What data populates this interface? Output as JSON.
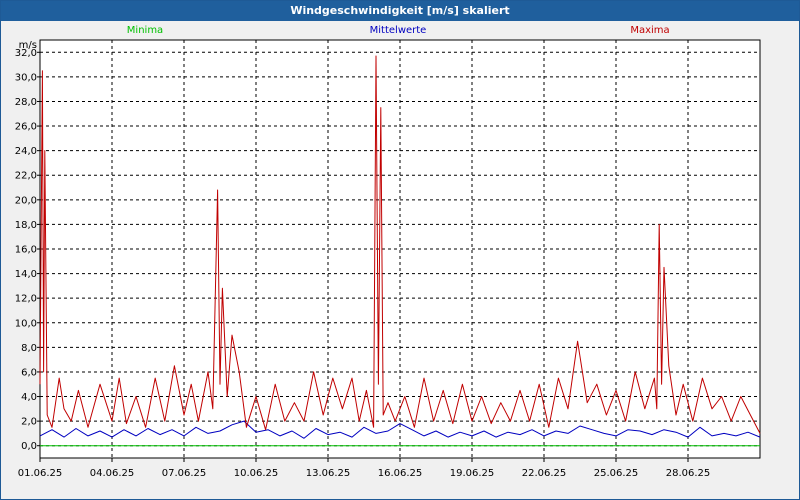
{
  "window": {
    "title": "Windgeschwindigkeit [m/s] skaliert"
  },
  "chart_data": {
    "type": "line",
    "title": "Windgeschwindigkeit [m/s] skaliert",
    "ylabel": "m/s",
    "ylim": [
      -1.0,
      33.0
    ],
    "yticks": [
      0,
      2,
      4,
      6,
      8,
      10,
      12,
      14,
      16,
      18,
      20,
      22,
      24,
      26,
      28,
      30,
      32
    ],
    "ytick_labels": [
      "0,0",
      "2,0",
      "4,0",
      "6,0",
      "8,0",
      "10,0",
      "12,0",
      "14,0",
      "16,0",
      "18,0",
      "20,0",
      "22,0",
      "24,0",
      "26,0",
      "28,0",
      "30,0",
      "32,0"
    ],
    "xlim": [
      0,
      30
    ],
    "xticks": [
      0,
      3,
      6,
      9,
      12,
      15,
      18,
      21,
      24,
      27
    ],
    "xtick_labels": [
      "01.06.25",
      "04.06.25",
      "07.06.25",
      "10.06.25",
      "13.06.25",
      "16.06.25",
      "19.06.25",
      "22.06.25",
      "25.06.25",
      "28.06.25"
    ],
    "grid": true,
    "legend_placement": "top",
    "series": [
      {
        "name": "Minima",
        "color": "#00c000",
        "x": [
          0,
          30
        ],
        "y": [
          0.0,
          0.0
        ]
      },
      {
        "name": "Mittelwerte",
        "color": "#0000c0",
        "x": [
          0,
          0.5,
          1,
          1.5,
          2,
          2.5,
          3,
          3.5,
          4,
          4.5,
          5,
          5.5,
          6,
          6.5,
          7,
          7.5,
          8,
          8.5,
          9,
          9.5,
          10,
          10.5,
          11,
          11.5,
          12,
          12.5,
          13,
          13.5,
          14,
          14.5,
          15,
          15.5,
          16,
          16.5,
          17,
          17.5,
          18,
          18.5,
          19,
          19.5,
          20,
          20.5,
          21,
          21.5,
          22,
          22.5,
          23,
          23.5,
          24,
          24.5,
          25,
          25.5,
          26,
          26.5,
          27,
          27.5,
          28,
          28.5,
          29,
          29.5,
          30
        ],
        "y": [
          0.8,
          1.3,
          0.7,
          1.4,
          0.8,
          1.2,
          0.7,
          1.3,
          0.8,
          1.4,
          0.9,
          1.3,
          0.8,
          1.5,
          1.0,
          1.2,
          1.7,
          2.0,
          1.1,
          1.3,
          0.8,
          1.2,
          0.6,
          1.4,
          0.9,
          1.1,
          0.7,
          1.5,
          1.0,
          1.2,
          1.8,
          1.3,
          0.8,
          1.2,
          0.7,
          1.1,
          0.8,
          1.2,
          0.7,
          1.1,
          0.9,
          1.3,
          0.8,
          1.2,
          1.0,
          1.6,
          1.3,
          1.0,
          0.8,
          1.3,
          1.2,
          0.9,
          1.3,
          1.1,
          0.7,
          1.5,
          0.8,
          1.0,
          0.8,
          1.1,
          0.7
        ]
      },
      {
        "name": "Maxima",
        "color": "#c00000",
        "x": [
          0,
          0.1,
          0.15,
          0.2,
          0.3,
          0.5,
          0.8,
          1.0,
          1.3,
          1.6,
          2.0,
          2.5,
          3.0,
          3.3,
          3.6,
          4.0,
          4.4,
          4.8,
          5.2,
          5.6,
          6.0,
          6.3,
          6.6,
          7.0,
          7.2,
          7.4,
          7.5,
          7.6,
          7.8,
          8.0,
          8.3,
          8.6,
          9.0,
          9.4,
          9.8,
          10.2,
          10.6,
          11.0,
          11.4,
          11.8,
          12.2,
          12.6,
          13.0,
          13.3,
          13.6,
          13.9,
          14.0,
          14.1,
          14.2,
          14.3,
          14.5,
          14.8,
          15.2,
          15.6,
          16.0,
          16.4,
          16.8,
          17.2,
          17.6,
          18.0,
          18.4,
          18.8,
          19.2,
          19.6,
          20.0,
          20.4,
          20.8,
          21.2,
          21.6,
          22.0,
          22.4,
          22.8,
          23.2,
          23.6,
          24.0,
          24.4,
          24.8,
          25.2,
          25.6,
          25.7,
          25.8,
          25.9,
          26.0,
          26.2,
          26.5,
          26.8,
          27.2,
          27.6,
          28.0,
          28.4,
          28.8,
          29.2,
          29.6,
          30.0
        ],
        "y": [
          5.0,
          30.5,
          6.0,
          24.0,
          2.5,
          1.5,
          5.5,
          3.0,
          2.0,
          4.5,
          1.5,
          5.0,
          2.0,
          5.5,
          1.8,
          4.0,
          1.5,
          5.5,
          2.0,
          6.5,
          2.5,
          5.0,
          2.0,
          6.0,
          3.0,
          20.8,
          5.0,
          12.8,
          4.0,
          9.0,
          6.0,
          1.5,
          4.0,
          1.3,
          5.0,
          2.0,
          3.5,
          2.0,
          6.0,
          2.5,
          5.5,
          3.0,
          5.5,
          2.0,
          4.5,
          1.5,
          31.7,
          5.0,
          27.5,
          2.5,
          3.5,
          2.0,
          4.0,
          1.5,
          5.5,
          2.0,
          4.5,
          1.8,
          5.0,
          2.0,
          4.0,
          1.8,
          3.5,
          2.0,
          4.5,
          2.0,
          5.0,
          1.5,
          5.5,
          3.0,
          8.5,
          3.5,
          5.0,
          2.5,
          4.5,
          2.0,
          6.0,
          3.0,
          5.5,
          3.0,
          18.0,
          5.0,
          14.5,
          6.5,
          2.5,
          5.0,
          2.0,
          5.5,
          3.0,
          4.0,
          2.0,
          4.0,
          2.5,
          1.0
        ]
      }
    ]
  }
}
